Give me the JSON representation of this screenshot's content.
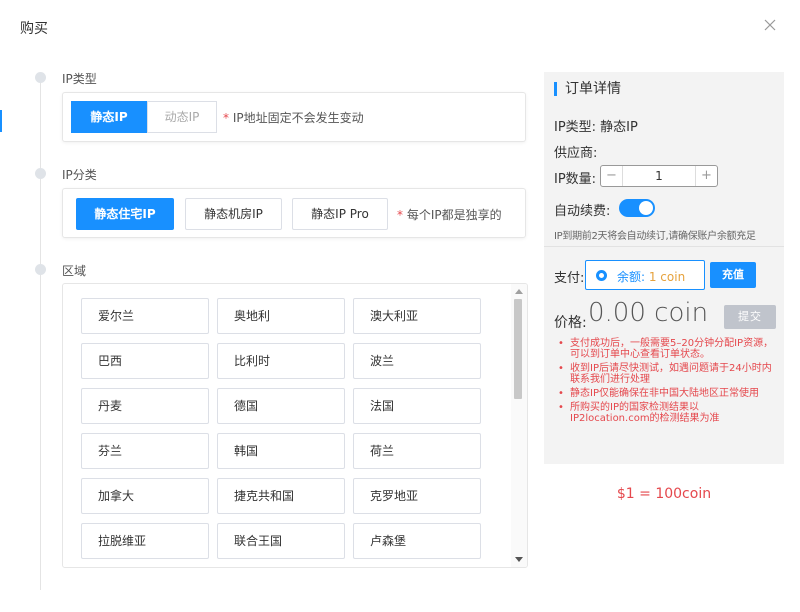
{
  "dialog": {
    "title": "购买"
  },
  "ip_type": {
    "label": "IP类型",
    "options": [
      "静态IP",
      "动态IP"
    ],
    "note_star": "*",
    "note": " IP地址固定不会发生变动"
  },
  "ip_category": {
    "label": "IP分类",
    "options": [
      "静态住宅IP",
      "静态机房IP",
      "静态IP Pro"
    ],
    "note_star": "*",
    "note": " 每个IP都是独享的"
  },
  "region": {
    "label": "区域",
    "countries": [
      "爱尔兰",
      "奥地利",
      "澳大利亚",
      "巴西",
      "比利时",
      "波兰",
      "丹麦",
      "德国",
      "法国",
      "芬兰",
      "韩国",
      "荷兰",
      "加拿大",
      "捷克共和国",
      "克罗地亚",
      "拉脱维亚",
      "联合王国",
      "卢森堡"
    ]
  },
  "order": {
    "title": "订单详情",
    "ip_type": "IP类型: 静态IP",
    "supplier": "供应商:",
    "qty_label": "IP数量:",
    "qty_minus": "−",
    "qty_value": "1",
    "qty_plus": "+",
    "auto_renew_label": "自动续费:",
    "auto_renew_on": true,
    "auto_renew_note": "IP到期前2天将会自动续订,请确保账户余额充足",
    "pay_label": "支付:",
    "balance_label": "余额: ",
    "balance_value": "1 coin",
    "recharge": "充值",
    "price_label": "价格:",
    "price_value": "0.00 coin",
    "submit": "提交",
    "notes": [
      "支付成功后，一般需要5–20分钟分配IP资源，可以到订单中心查看订单状态。",
      "收到IP后请尽快测试，如遇问题请于24小时内联系我们进行处理",
      "静态IP仅能确保在非中国大陆地区正常使用",
      "所购买的IP的国家检测结果以IP2location.com的检测结果为准"
    ]
  },
  "rate": "$1 = 100coin",
  "colors": {
    "accent": "#1890ff",
    "warning": "#e5484d",
    "balance": "#e6a23c"
  }
}
